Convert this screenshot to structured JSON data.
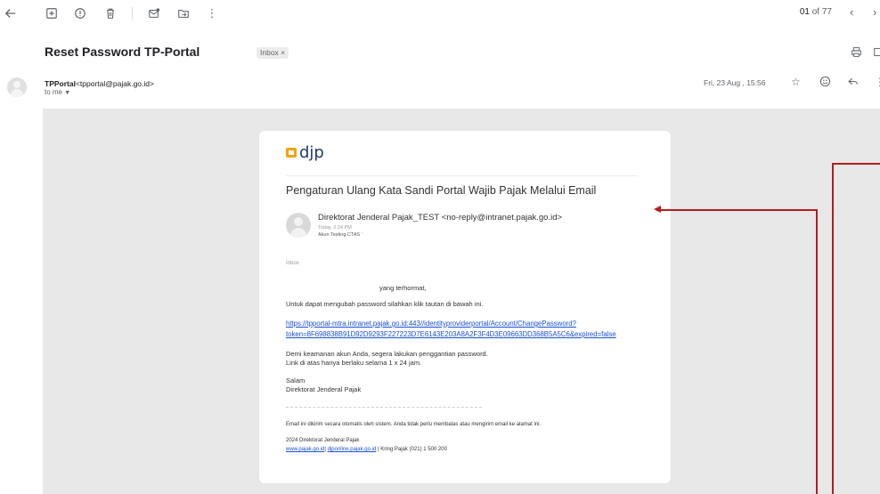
{
  "toolbar": {
    "back_icon": "arrow-left-icon",
    "pager_current": "01",
    "pager_total": "of 77",
    "prev_icon": "chevron-left-icon",
    "next_icon": "chevron-right-icon"
  },
  "message": {
    "subject": "Reset Password TP-Portal",
    "label": "Inbox ×",
    "sender_name": "TPPortal",
    "sender_email": "<tpportal@pajak.go.id>",
    "to": "to me",
    "date": "Fri, 23 Aug , 15:56"
  },
  "email_card": {
    "logo_text": "djp",
    "title": "Pengaturan Ulang Kata Sandi Portal Wajib Pajak Melalui Email",
    "from": "Direktorat Jenderal Pajak_TEST <no-reply@intranet.pajak.go.id>",
    "time": "Today, 2:24 PM",
    "to": "Akun Testing CTAS",
    "folder": "Inbox",
    "greeting": "yang terhormat,",
    "instruction": "Untuk dapat mengubah password silahkan klik tautan di bawah ini.",
    "link_line1": "https://tpportal-mtra.intranet.pajak.go.id:443//identityproviderportal/Account/ChangePassword?",
    "link_line2": "token=8F698838B91D92D9293F227223D7E6143E203A8A2F3F4D3E09663DD368B5A5C6&expired=false",
    "security_line1": "Demi keamanan akun Anda, segera lakukan penggantian password.",
    "security_line2": "Link di atas hanya berlaku selama 1 x 24 jam.",
    "closing": "Salam",
    "signature": "Direktorat Jenderal Pajak",
    "auto_notice": "Email ini dikirim secara otomatis oleh sistem. Anda tidak perlu membalas atau mengirim email ke alamat ini.",
    "footer_org": "2024 Direktorat Jenderal Pajak",
    "footer_link1": "www.pajak.go.id",
    "footer_sep": "|",
    "footer_link2": "djponline.pajak.go.id",
    "footer_kring": "| Kring Pajak (021) 1 500 200"
  },
  "colors": {
    "annotation_red": "#b71c1c",
    "link_blue": "#1a4fd6",
    "logo_orange": "#f2a50c",
    "logo_navy": "#1f3a6e"
  }
}
